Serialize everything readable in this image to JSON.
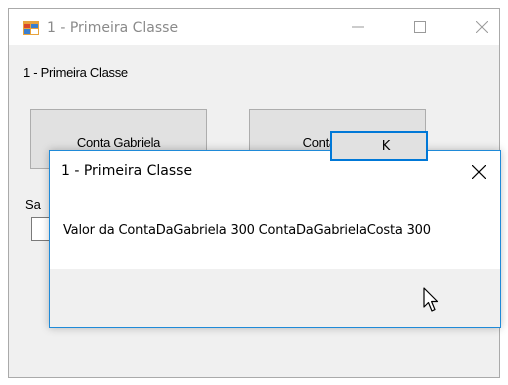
{
  "window": {
    "title": "1 - Primeira Classe",
    "icon": "windows-form-icon",
    "controls": [
      "minimize-icon",
      "maximize-icon",
      "close-icon"
    ]
  },
  "form": {
    "header_label": "1 - Primeira Classe",
    "button_gabriela": "Conta Gabriela",
    "button_bruno": "Conta Bruno",
    "saldo_label": "Sa",
    "saldo_value": ""
  },
  "dialog": {
    "title": "1 - Primeira Classe",
    "message": "Valor da ContaDaGabriela 300 ContaDaGabrielaCosta 300",
    "ok_label": "K",
    "accent": "#0078d7"
  }
}
